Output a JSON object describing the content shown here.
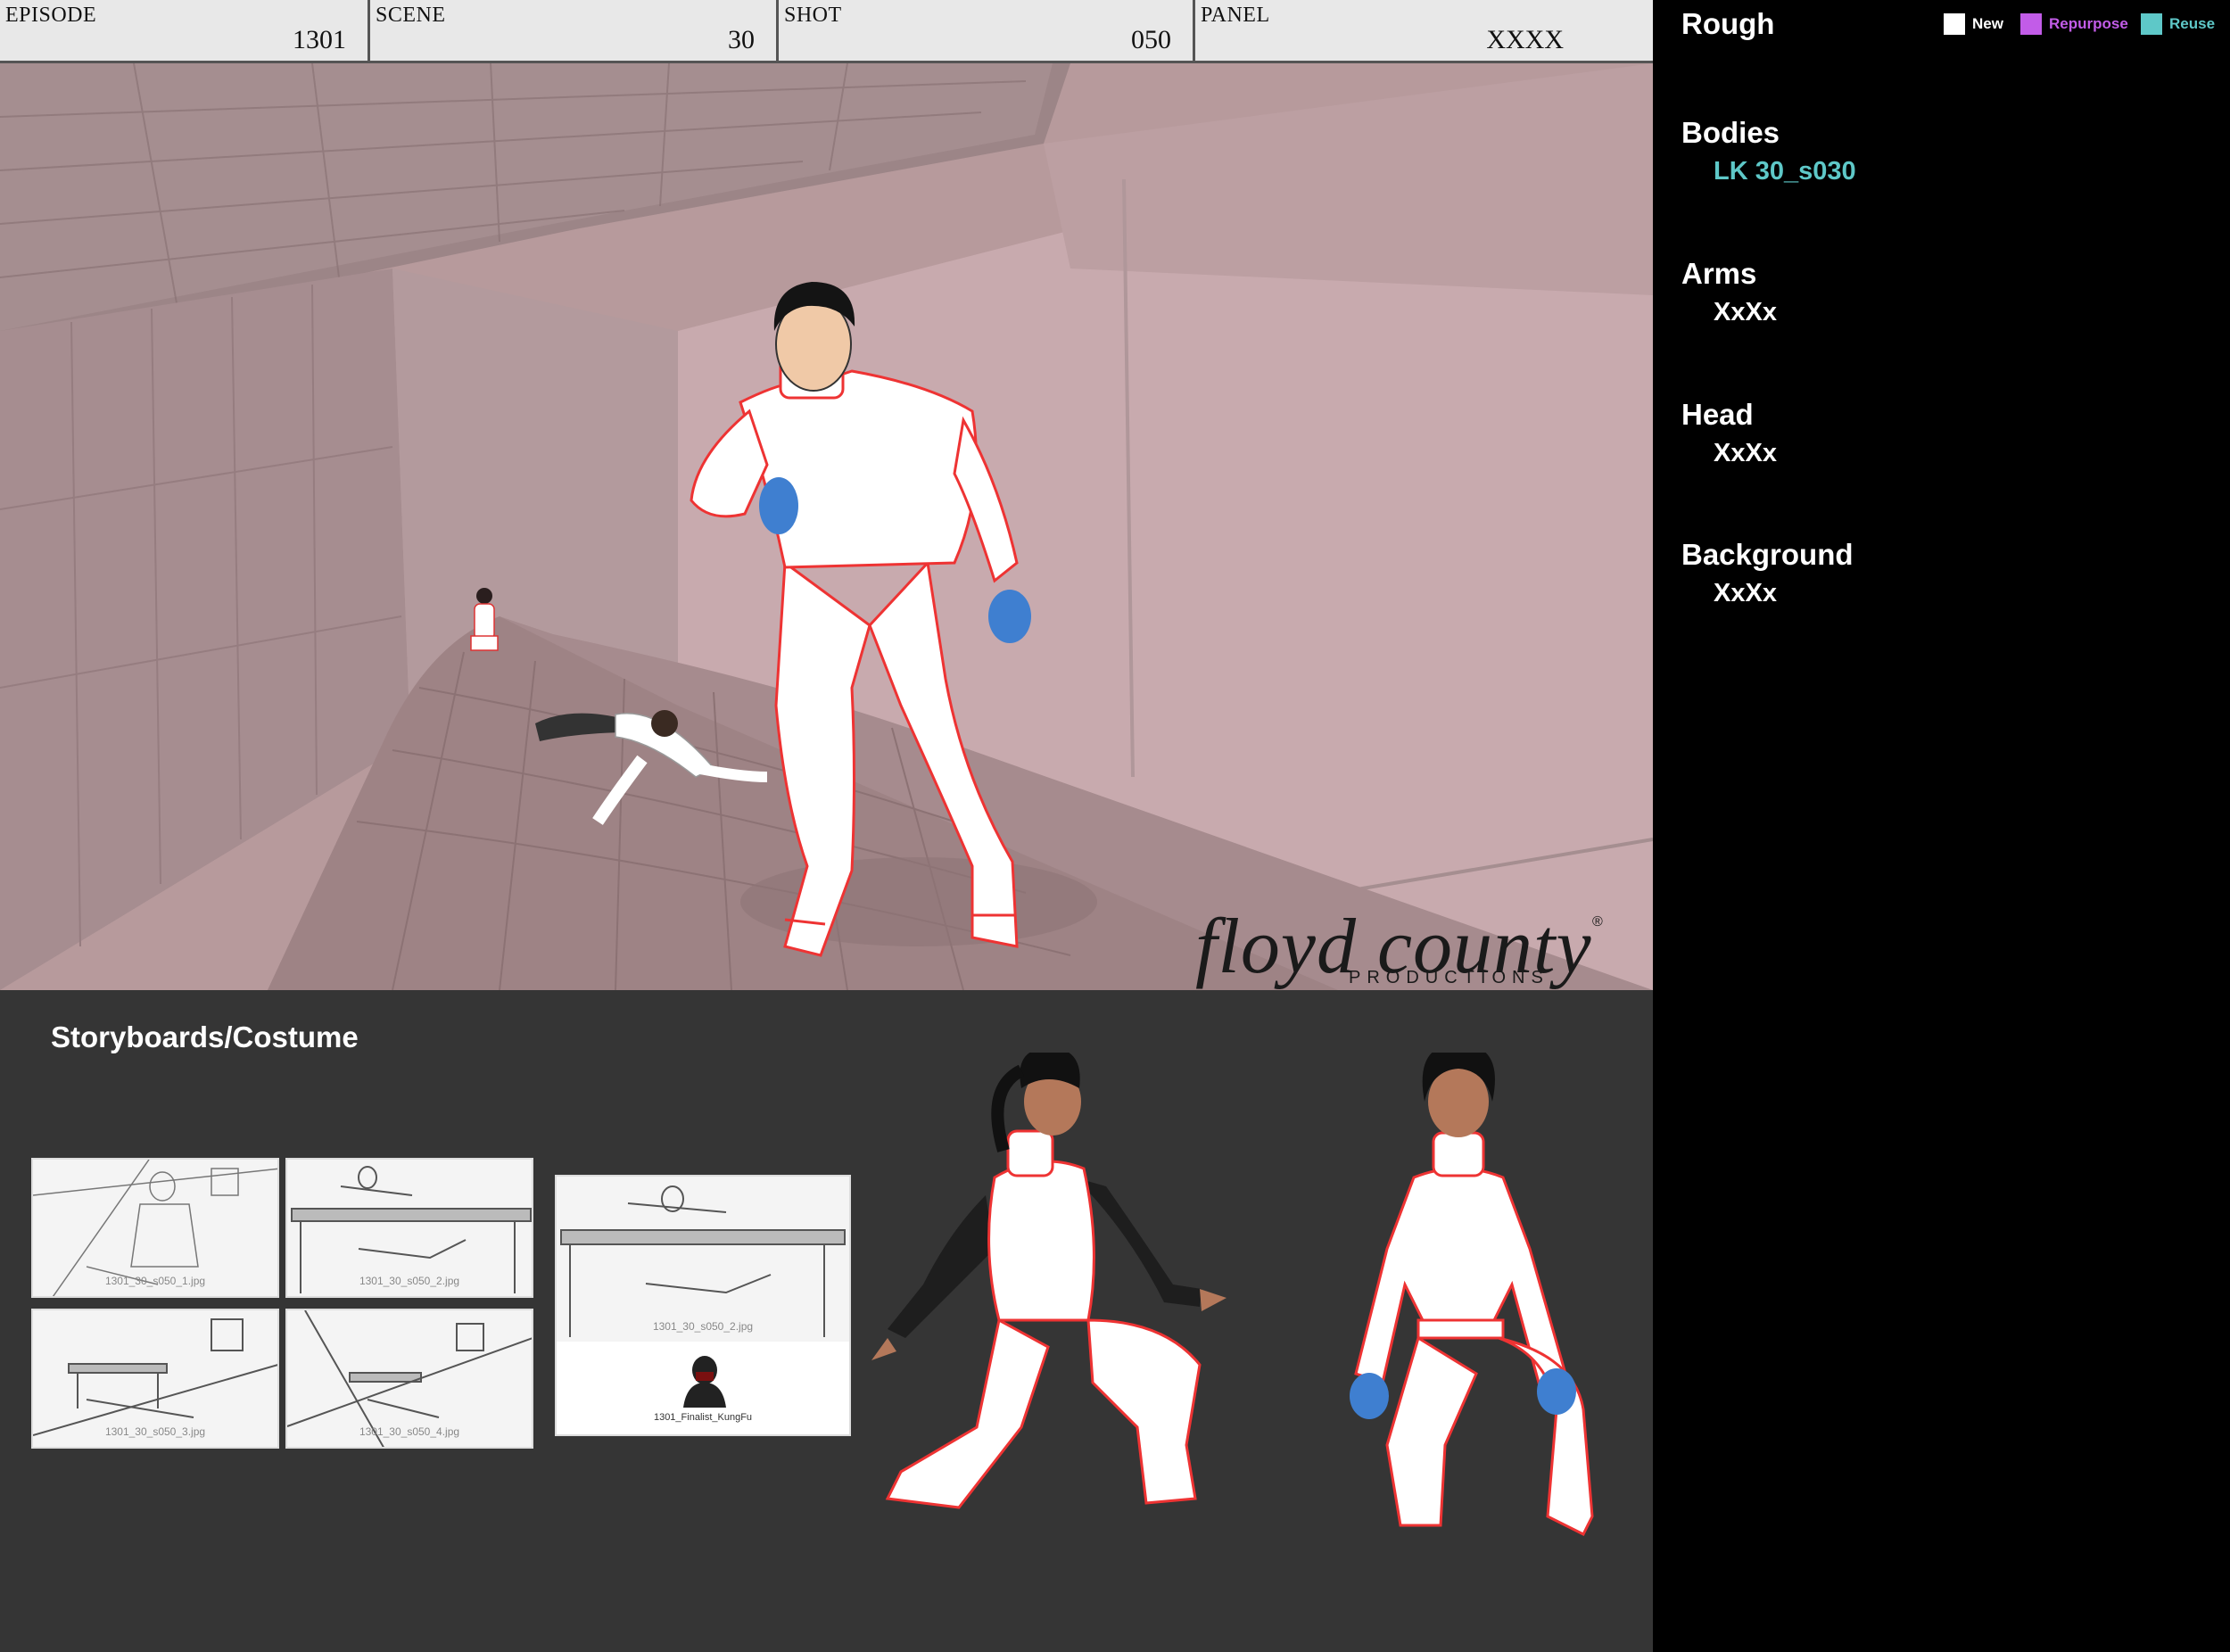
{
  "slate": {
    "episode_label": "EPISODE",
    "episode_value": "1301",
    "scene_label": "SCENE",
    "scene_value": "30",
    "shot_label": "SHOT",
    "shot_value": "050",
    "panel_label": "PANEL",
    "panel_value": "XXXX"
  },
  "logo": {
    "script": "floyd county",
    "sub": "PRODUCTIONS",
    "reg": "®"
  },
  "sidebar": {
    "title": "Rough",
    "legend": [
      {
        "label": "New",
        "color": "#ffffff"
      },
      {
        "label": "Repurpose",
        "color": "#c25ce8"
      },
      {
        "label": "Reuse",
        "color": "#5ec8c8"
      }
    ],
    "sections": [
      {
        "heading": "Bodies",
        "value": "LK 30_s030",
        "status": "reuse"
      },
      {
        "heading": "Arms",
        "value": "XxXx",
        "status": "new"
      },
      {
        "heading": "Head",
        "value": "XxXx",
        "status": "new"
      },
      {
        "heading": "Background",
        "value": "XxXx",
        "status": "new"
      }
    ]
  },
  "storyboards": {
    "title": "Storyboards/Costume",
    "thumbs": [
      {
        "caption": "1301_30_s050_1.jpg"
      },
      {
        "caption": "1301_30_s050_2.jpg"
      },
      {
        "caption": "1301_30_s050_3.jpg"
      },
      {
        "caption": "1301_30_s050_4.jpg"
      },
      {
        "caption": "1301_30_s050_2.jpg"
      }
    ],
    "ref_caption": "1301_Finalist_KungFu"
  },
  "colors": {
    "accent_reuse": "#5ec8c8",
    "accent_repurpose": "#c25ce8",
    "panel_bg": "#b79a9c",
    "bottom_bg": "#353535"
  }
}
